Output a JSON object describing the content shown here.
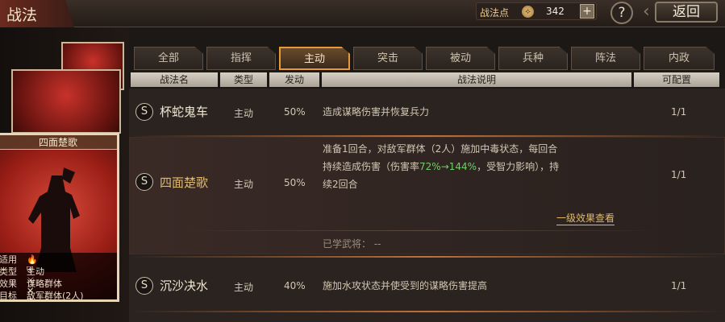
{
  "header": {
    "title": "战法",
    "points_label": "战法点",
    "points_icon_glyph": "⟡",
    "points_value": "342",
    "add_label": "+",
    "help_label": "?",
    "back_label": "返回"
  },
  "card": {
    "title": "四面楚歌",
    "info": [
      {
        "key": "适用",
        "value": ""
      },
      {
        "key": "类型",
        "value": "主动"
      },
      {
        "key": "效果",
        "value": "谋略群体"
      },
      {
        "key": "目标",
        "value": "敌军群体(2人)"
      }
    ],
    "troop_icons": "🔥 ⛨ ⚔ ✕ ✱"
  },
  "tabs": [
    "全部",
    "指挥",
    "主动",
    "突击",
    "被动",
    "兵种",
    "阵法",
    "内政"
  ],
  "active_tab": "主动",
  "columns": [
    "战法名",
    "类型",
    "发动",
    "战法说明",
    "可配置"
  ],
  "rows": [
    {
      "badge": "S",
      "name": "杯蛇鬼车",
      "type": "主动",
      "rate": "50%",
      "desc": "造成谋略伤害并恢复兵力",
      "config": "1/1"
    },
    {
      "badge": "S",
      "name": "四面楚歌",
      "type": "主动",
      "rate": "50%",
      "desc_line1": "准备1回合，对敌军群体（2人）施加中毒状态，每回合",
      "desc_line2_a": "持续造成伤害（伤害率",
      "desc_line2_hl": "72%→144%",
      "desc_line2_b": "，受智力影响），持",
      "desc_line3": "续2回合",
      "link": "一级效果查看",
      "learned": "已学武将：  --",
      "config": "1/1"
    },
    {
      "badge": "S",
      "name": "沉沙决水",
      "type": "主动",
      "rate": "40%",
      "desc": "施加水攻状态并使受到的谋略伤害提高",
      "config": "1/1"
    }
  ]
}
